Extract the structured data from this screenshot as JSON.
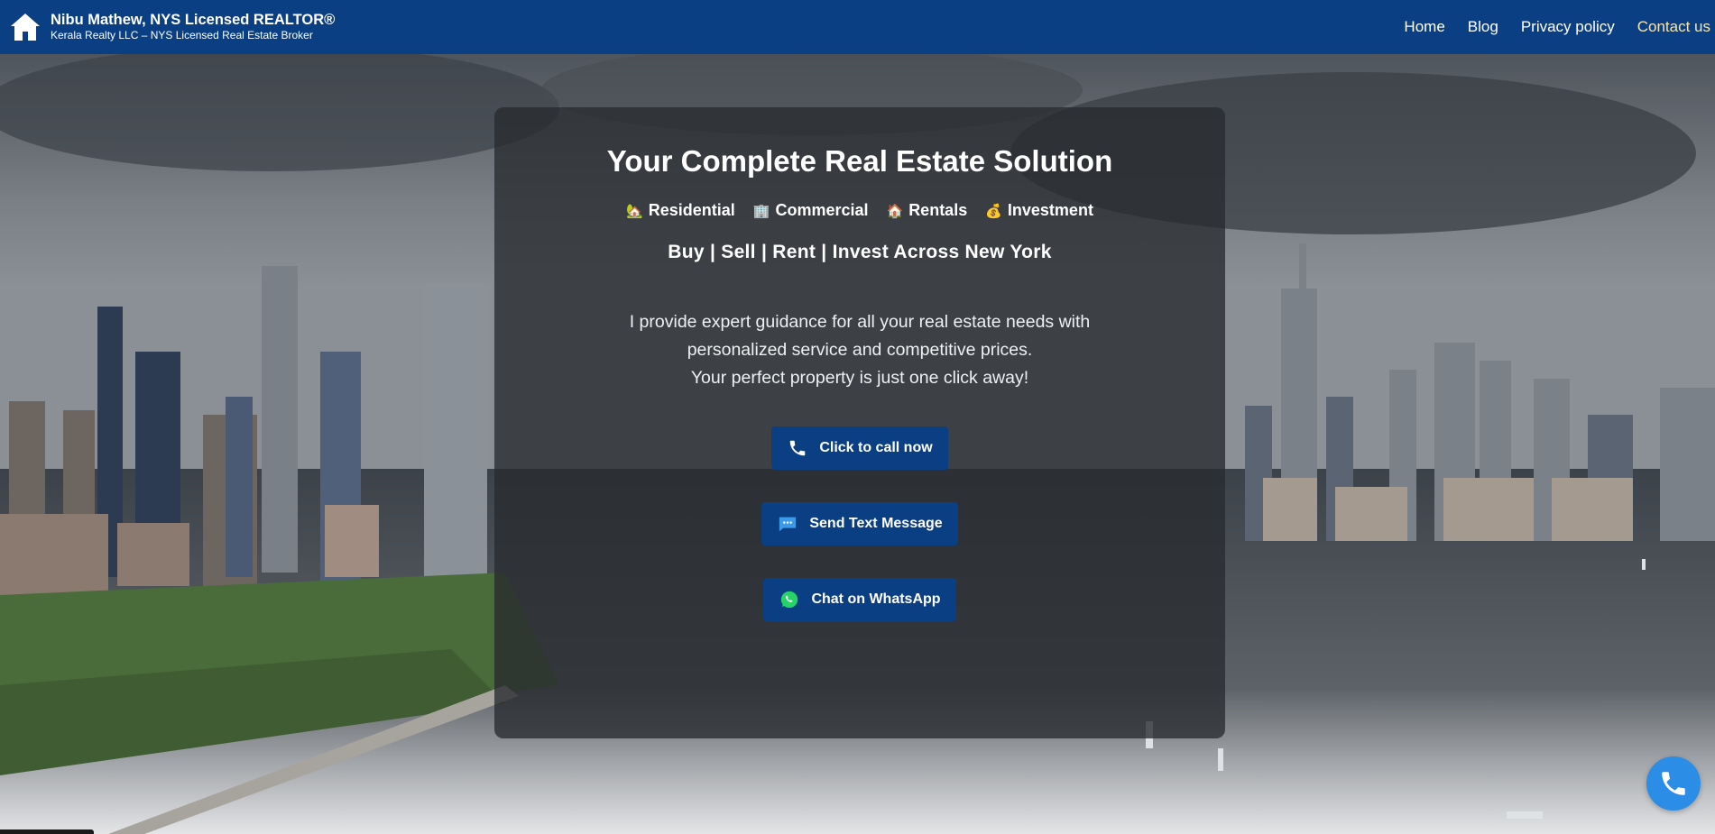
{
  "header": {
    "name": "Nibu Mathew, NYS Licensed REALTOR®",
    "tagline": "Kerala Realty LLC – NYS Licensed Real Estate Broker",
    "nav": [
      {
        "label": "Home"
      },
      {
        "label": "Blog"
      },
      {
        "label": "Privacy policy"
      },
      {
        "label": "Contact us"
      }
    ]
  },
  "hero": {
    "title": "Your Complete Real Estate Solution",
    "categories": [
      {
        "emoji": "🏡",
        "label": "Residential"
      },
      {
        "emoji": "🏢",
        "label": "Commercial"
      },
      {
        "emoji": "🏠",
        "label": "Rentals"
      },
      {
        "emoji": "💰",
        "label": "Investment"
      }
    ],
    "tagline": "Buy | Sell | Rent | Invest Across New York",
    "description_line1": "I provide expert guidance for all your real estate needs with",
    "description_line2": "personalized service and competitive prices.",
    "description_line3": "Your perfect property is just one click away!",
    "buttons": {
      "call": "Click to call now",
      "text": "Send Text Message",
      "whatsapp": "Chat on WhatsApp"
    }
  },
  "colors": {
    "header_bg": "#0b3f84",
    "button_bg": "#0b3f84",
    "active_nav": "#f5e6b0",
    "fab_bg": "#2b8de6"
  },
  "icons": {
    "brand": "home-icon",
    "call": "phone-icon",
    "text": "message-icon",
    "whatsapp": "whatsapp-icon",
    "fab": "phone-icon"
  }
}
